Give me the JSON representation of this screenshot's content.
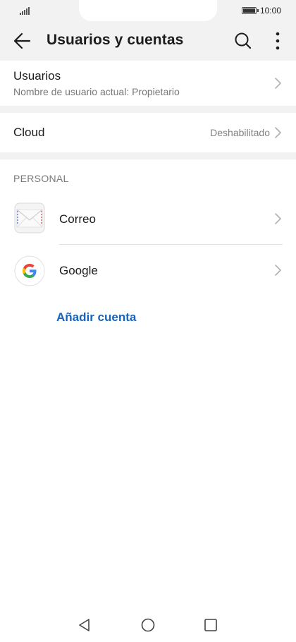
{
  "status": {
    "time": "10:00"
  },
  "appbar": {
    "title": "Usuarios y cuentas"
  },
  "users": {
    "title": "Usuarios",
    "subtitle": "Nombre de usuario actual: Propietario"
  },
  "cloud": {
    "title": "Cloud",
    "value": "Deshabilitado"
  },
  "personal": {
    "section_title": "PERSONAL",
    "accounts": [
      {
        "label": "Correo",
        "icon": "mail-icon"
      },
      {
        "label": "Google",
        "icon": "google-icon"
      }
    ],
    "add_account": "Añadir cuenta"
  },
  "colors": {
    "accent": "#1565c0",
    "background": "#f2f2f2",
    "card": "#ffffff"
  }
}
